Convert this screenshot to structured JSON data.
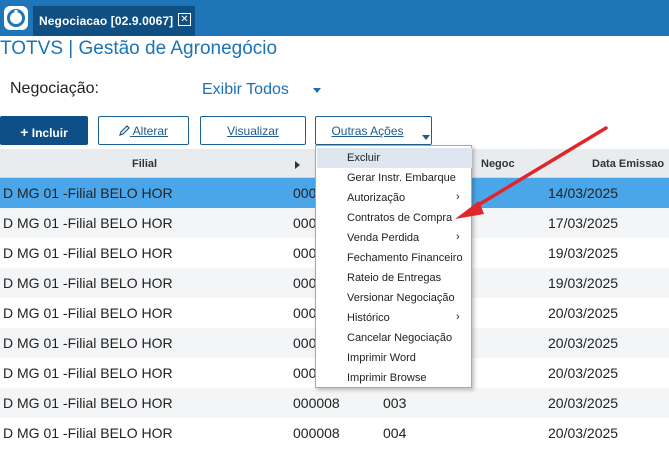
{
  "topbar": {
    "logo_icon": "totvs-logo-icon",
    "tab_title": "Negociacao [02.9.0067]",
    "tab_close_glyph": "✕",
    "color": "#1e75b8"
  },
  "app_title": "TOTVS | Gestão de Agronegócio",
  "filter": {
    "label": "Negociação:",
    "value": "Exibir Todos"
  },
  "toolbar": {
    "incluir_label": "Incluir",
    "alterar_label": "Alterar",
    "visualizar_label": "Visualizar",
    "outras_label": "Outras Ações"
  },
  "grid": {
    "columns": [
      "Filial",
      "Negoc",
      "Data Emissao"
    ],
    "rows": [
      {
        "filial": "D MG 01 -Filial BELO HOR",
        "num": "000",
        "seq": "",
        "data": "14/03/2025",
        "selected": true
      },
      {
        "filial": "D MG 01 -Filial BELO HOR",
        "num": "000",
        "seq": "",
        "data": "17/03/2025"
      },
      {
        "filial": "D MG 01 -Filial BELO HOR",
        "num": "000",
        "seq": "",
        "data": "19/03/2025"
      },
      {
        "filial": "D MG 01 -Filial BELO HOR",
        "num": "000",
        "seq": "",
        "data": "19/03/2025"
      },
      {
        "filial": "D MG 01 -Filial BELO HOR",
        "num": "000",
        "seq": "",
        "data": "20/03/2025"
      },
      {
        "filial": "D MG 01 -Filial BELO HOR",
        "num": "000",
        "seq": "",
        "data": "20/03/2025"
      },
      {
        "filial": "D MG 01 -Filial BELO HOR",
        "num": "000",
        "seq": "",
        "data": "20/03/2025"
      },
      {
        "filial": "D MG 01 -Filial BELO HOR",
        "num": "000008",
        "seq": "003",
        "data": "20/03/2025"
      },
      {
        "filial": "D MG 01 -Filial BELO HOR",
        "num": "000008",
        "seq": "004",
        "data": "20/03/2025"
      }
    ],
    "selected_color": "#4aa6e8"
  },
  "menu": {
    "items": [
      {
        "label": "Excluir",
        "submenu": false,
        "active": true
      },
      {
        "label": "Gerar Instr. Embarque",
        "submenu": false
      },
      {
        "label": "Autorização",
        "submenu": true
      },
      {
        "label": "Contratos de Compra",
        "submenu": false
      },
      {
        "label": "Venda Perdida",
        "submenu": true
      },
      {
        "label": "Fechamento Financeiro",
        "submenu": false
      },
      {
        "label": "Rateio de Entregas",
        "submenu": false
      },
      {
        "label": "Versionar Negociação",
        "submenu": false
      },
      {
        "label": "Histórico",
        "submenu": true
      },
      {
        "label": "Cancelar Negociação",
        "submenu": false
      },
      {
        "label": "Imprimir Word",
        "submenu": false
      },
      {
        "label": "Imprimir Browse",
        "submenu": false
      }
    ],
    "submenu_glyph": "›"
  },
  "annotation": {
    "color": "#e0262b"
  }
}
